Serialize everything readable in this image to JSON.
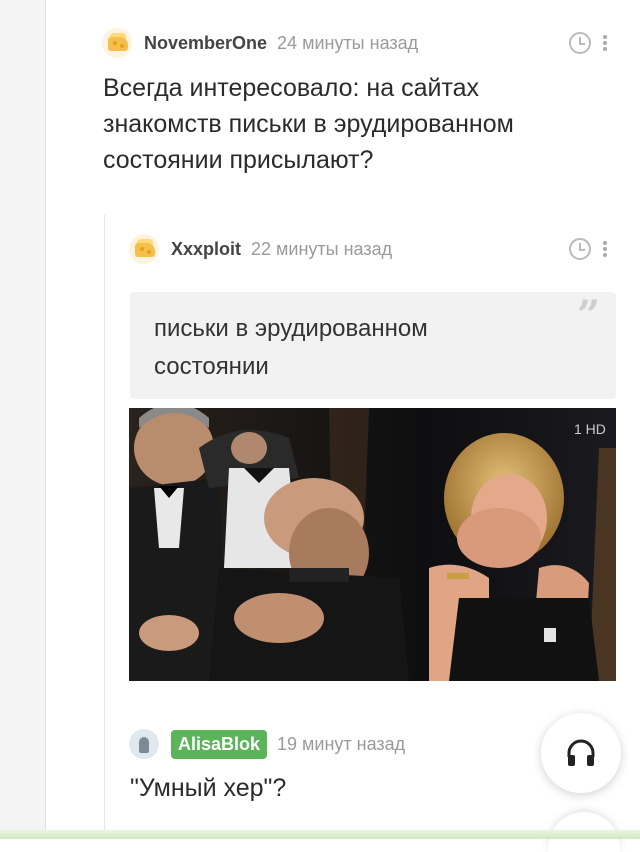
{
  "comments": [
    {
      "author": "NovemberOne",
      "time": "24 минуты назад",
      "avatar_icon": "cheese-avatar-icon",
      "text_lines": [
        "Всегда интересовало: на сайтах",
        "знакомств письки в эрудированном",
        "состоянии присылают?"
      ]
    },
    {
      "author": "Xxxploit",
      "time": "22 минуты назад",
      "avatar_icon": "cheese-avatar-icon",
      "quote_lines": [
        "письки в эрудированном",
        "состоянии"
      ],
      "media": "photo-audience-laughing"
    },
    {
      "author": "AlisaBlok",
      "time": "19 минут назад",
      "avatar_icon": "alisa-avatar-icon",
      "text": "\"Умный хер\"?"
    }
  ],
  "photo_watermark": "1 HD",
  "quote_mark": "”",
  "colors": {
    "accent_green": "#5bb45a",
    "muted_text": "#9a9a9a"
  }
}
